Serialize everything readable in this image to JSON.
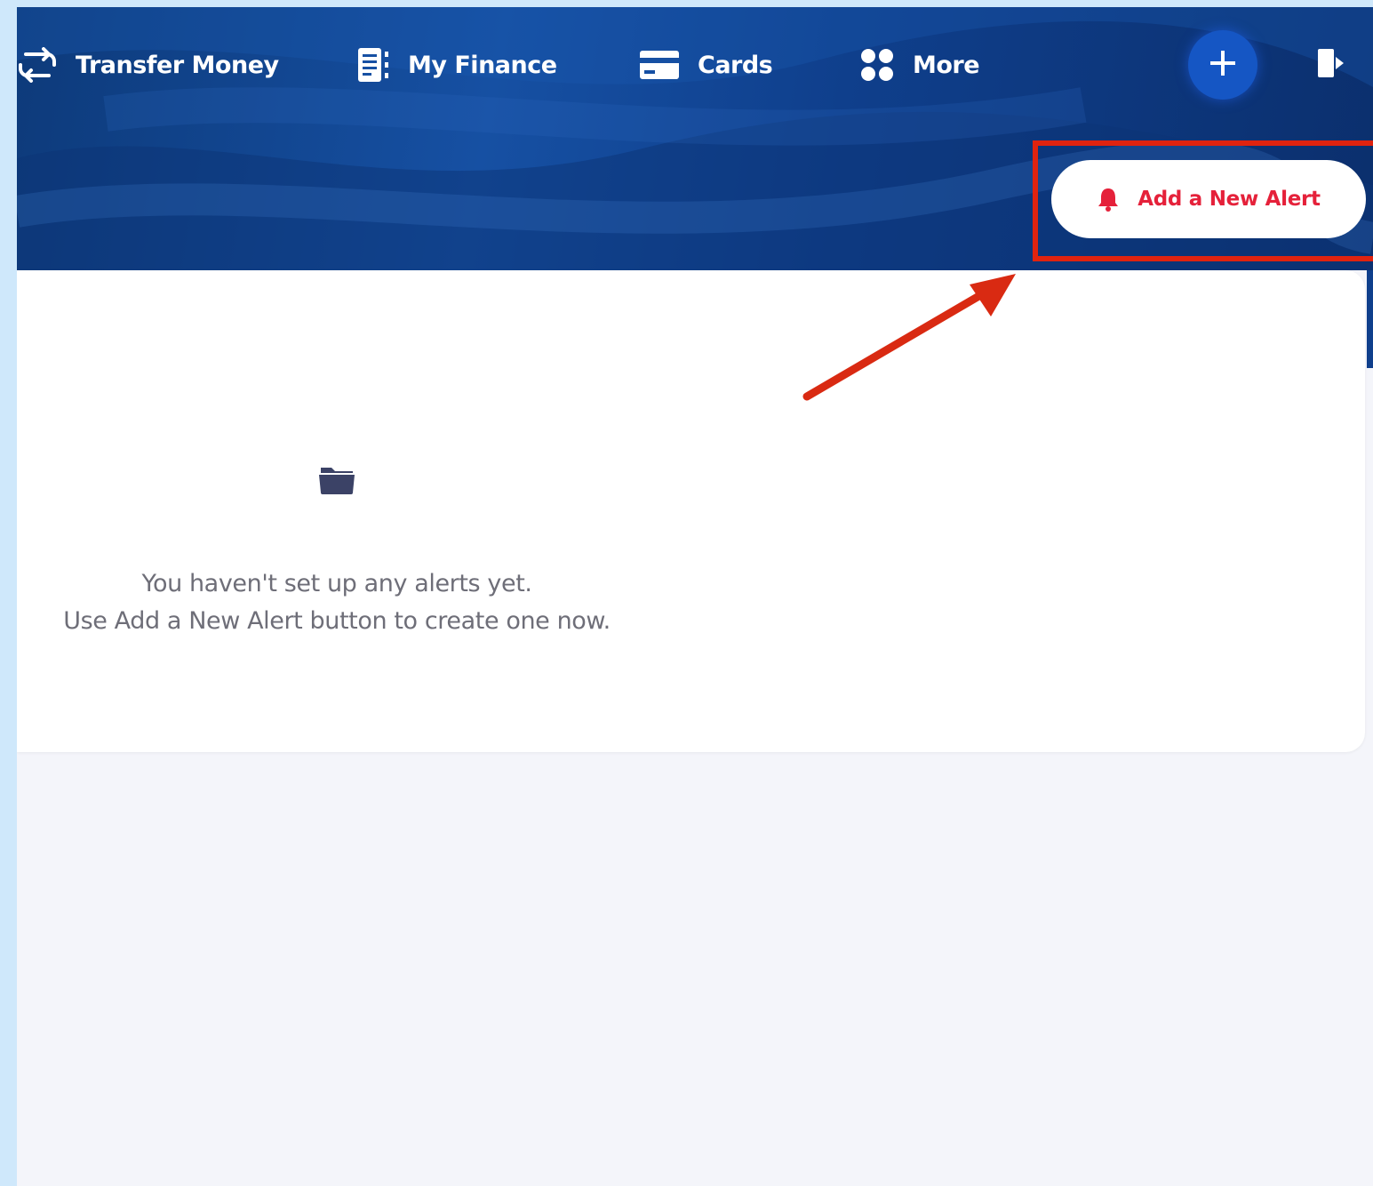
{
  "nav": {
    "items": [
      {
        "label": "Transfer Money",
        "icon": "transfer-icon"
      },
      {
        "label": "My Finance",
        "icon": "finance-ledger-icon"
      },
      {
        "label": "Cards",
        "icon": "credit-card-icon"
      },
      {
        "label": "More",
        "icon": "grid-dots-icon"
      }
    ],
    "add_icon": "plus-icon",
    "logout_icon": "logout-icon"
  },
  "header": {
    "add_alert_label": "Add a New Alert",
    "add_alert_icon": "bell-icon"
  },
  "empty_state": {
    "icon": "folder-icon",
    "line1": "You haven't set up any alerts yet.",
    "line2": "Use Add a New Alert button to create one now."
  },
  "annotation": {
    "highlight_color": "#e0230f",
    "arrow_color": "#d92a12"
  },
  "colors": {
    "accent_red": "#e5213a",
    "header_blue": "#1650a3",
    "plus_button_blue": "#1556c4"
  }
}
